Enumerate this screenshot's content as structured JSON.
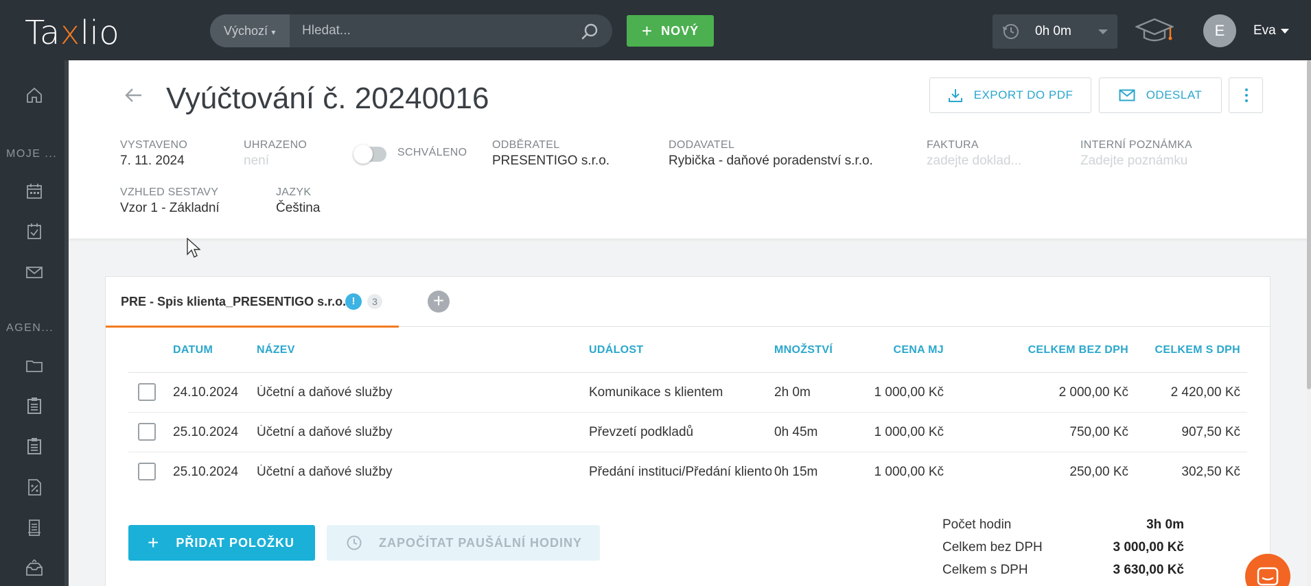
{
  "app": {
    "logo_text_pre": "Ta",
    "logo_text_x": "x",
    "logo_text_post": "lio",
    "brand_color": "#f47a20",
    "accent_color": "#2aa7cd"
  },
  "topbar": {
    "search_scope": "Výchozí",
    "search_placeholder": "Hledat...",
    "new_button": "NOVÝ",
    "timer_value": "0h 0m",
    "user_initial": "E",
    "user_name": "Eva"
  },
  "sidebar": {
    "section_mine": "MOJE ...",
    "section_agenda": "AGEN...",
    "items": [
      "home-icon",
      "calendar-icon",
      "tasks-icon",
      "mail-icon",
      "folder-icon",
      "clipboard-icon",
      "clipboard-icon",
      "invoice-icon",
      "document-icon",
      "inbox-icon"
    ]
  },
  "header": {
    "title": "Vyúčtování č. 20240016",
    "export_button": "EXPORT DO PDF",
    "send_button": "ODESLAT",
    "meta": {
      "issued_label": "VYSTAVENO",
      "issued_value": "7. 11. 2024",
      "paid_label": "UHRAZENO",
      "paid_value": "není",
      "approved_label": "SCHVÁLENO",
      "customer_label": "ODBĚRATEL",
      "customer_value": "PRESENTIGO s.r.o.",
      "supplier_label": "DODAVATEL",
      "supplier_value": "Rybička - daňové poradenství s.r.o.",
      "invoice_label": "FAKTURA",
      "invoice_placeholder": "zadejte doklad...",
      "note_label": "INTERNÍ POZNÁMKA",
      "note_placeholder": "Zadejte poznámku",
      "layout_label": "VZHLED SESTAVY",
      "layout_value": "Vzor 1 - Základní",
      "language_label": "JAZYK",
      "language_value": "Čeština"
    }
  },
  "tab": {
    "label": "PRE - Spis klienta_PRESENTIGO s.r.o.",
    "alert": "!",
    "count": "3"
  },
  "table": {
    "headers": {
      "date": "DATUM",
      "name": "NÁZEV",
      "event": "UDÁLOST",
      "qty": "MNOŽSTVÍ",
      "unit_price": "CENA MJ",
      "total_net": "CELKEM BEZ DPH",
      "total_gross": "CELKEM S DPH"
    },
    "rows": [
      {
        "date": "24.10.2024",
        "name": "Účetní a daňové služby",
        "event": "Komunikace s klientem",
        "qty": "2h 0m",
        "unit_price": "1 000,00 Kč",
        "total_net": "2 000,00 Kč",
        "total_gross": "2 420,00 Kč"
      },
      {
        "date": "25.10.2024",
        "name": "Účetní a daňové služby",
        "event": "Převzetí podkladů",
        "qty": "0h 45m",
        "unit_price": "1 000,00 Kč",
        "total_net": "750,00 Kč",
        "total_gross": "907,50 Kč"
      },
      {
        "date": "25.10.2024",
        "name": "Účetní a daňové služby",
        "event": "Předání instituci/Předání klientovi",
        "qty": "0h 15m",
        "unit_price": "1 000,00 Kč",
        "total_net": "250,00 Kč",
        "total_gross": "302,50 Kč"
      }
    ]
  },
  "actions": {
    "add_item": "PŘIDAT POLOŽKU",
    "flat_hours": "ZAPOČÍTAT PAUŠÁLNÍ HODINY"
  },
  "summary": {
    "hours_label": "Počet hodin",
    "hours_value": "3h 0m",
    "net_label": "Celkem bez DPH",
    "net_value": "3 000,00 Kč",
    "gross_label": "Celkem s DPH",
    "gross_value": "3 630,00 Kč"
  }
}
